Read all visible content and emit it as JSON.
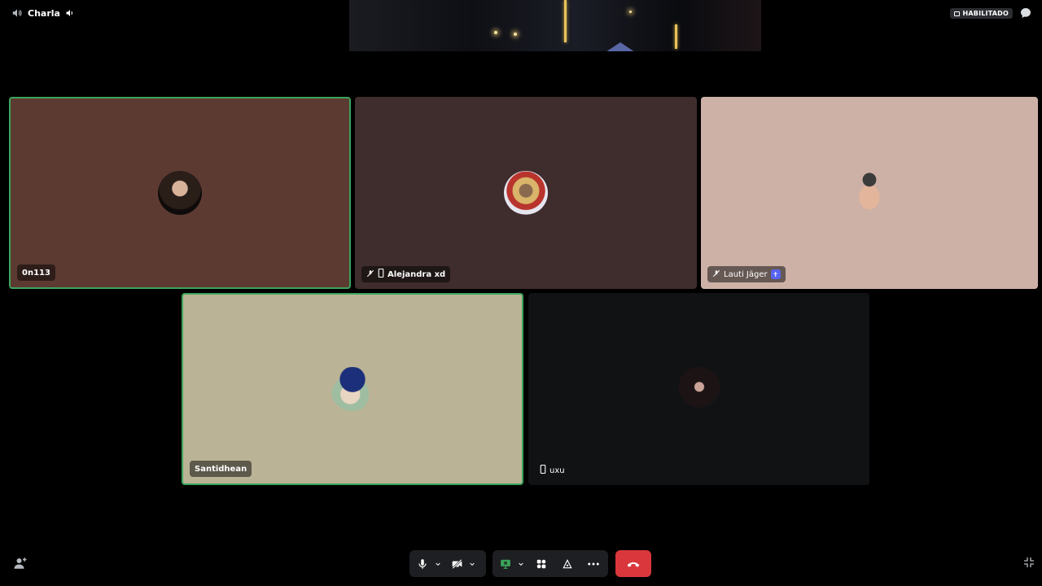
{
  "channel": {
    "name": "Charla",
    "icon": "speaker-icon",
    "status_icon": "volume-icon"
  },
  "header": {
    "badge_label": "HABILITADO",
    "chat_icon": "chat-bubble-icon"
  },
  "participants": [
    {
      "name": "0n113",
      "speaking": true,
      "bg": "#5c3a32",
      "icons": []
    },
    {
      "name": "Alejandra xd",
      "speaking": false,
      "bg": "#3f2c2c",
      "icons": [
        "mic-muted-icon",
        "mobile-icon"
      ]
    },
    {
      "name": "Lauti Jäger",
      "speaking": false,
      "bg": "#cdb1a6",
      "icons": [
        "mic-muted-icon"
      ],
      "badge": "✝"
    },
    {
      "name": "Santidhean",
      "speaking": true,
      "bg": "#bbb396",
      "icons": []
    },
    {
      "name": "uxu",
      "speaking": false,
      "bg": "#111214",
      "icons": [
        "mobile-icon"
      ]
    }
  ],
  "controls": {
    "mic": "microphone-icon",
    "camera": "camera-off-icon",
    "screen_share": "screen-share-icon",
    "activities": "activities-icon",
    "soundboard": "soundboard-icon",
    "more": "more-icon",
    "disconnect": "hang-up-icon"
  },
  "colors": {
    "speaking": "#3ba55c",
    "disconnect": "#da373c",
    "screen_share": "#3ba55c",
    "badge": "#5865f2"
  }
}
